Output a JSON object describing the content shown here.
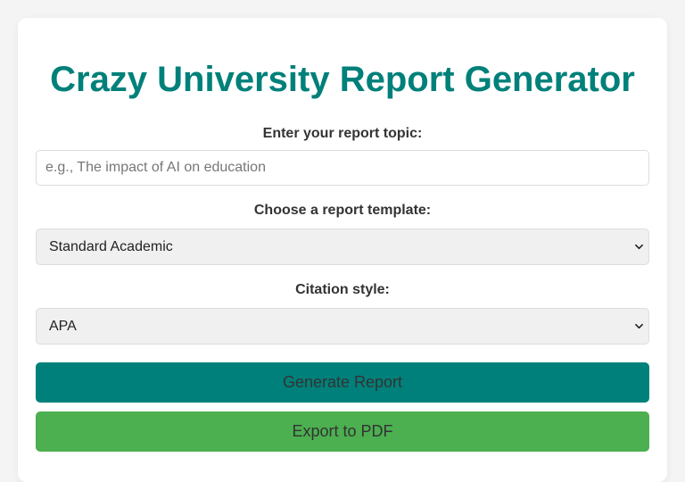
{
  "app": {
    "title": "Crazy University Report Generator"
  },
  "form": {
    "topic_label": "Enter your report topic:",
    "topic_placeholder": "e.g., The impact of AI on education",
    "topic_value": "",
    "template_label": "Choose a report template:",
    "template_selected": "Standard Academic",
    "citation_label": "Citation style:",
    "citation_selected": "APA"
  },
  "actions": {
    "generate_label": "Generate Report",
    "export_label": "Export to PDF"
  },
  "colors": {
    "accent": "#00807a",
    "export": "#4caf50",
    "background": "#f4f4f4"
  },
  "icons": {
    "select_indicator": "chevron-down-icon"
  }
}
